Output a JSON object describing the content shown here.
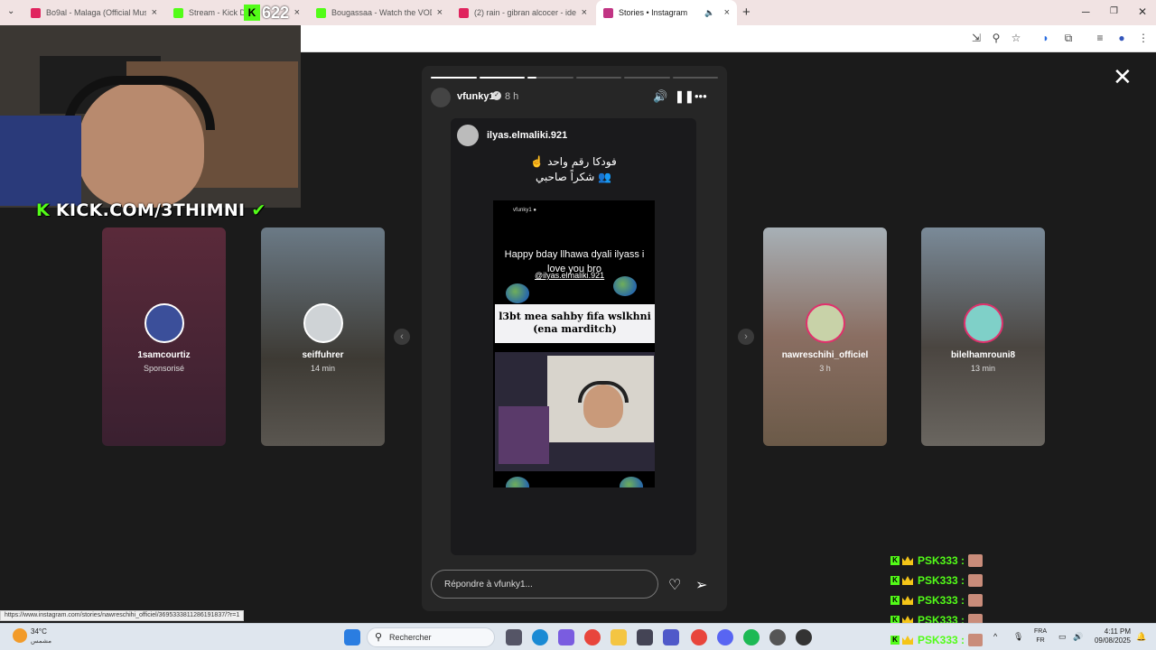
{
  "browser": {
    "tabs": [
      {
        "title": "Bo9al - Malaga (Official Music V",
        "color": "#e0245e"
      },
      {
        "title": "Stream - Kick Dash",
        "color": "#53fc18"
      },
      {
        "title": "Bougassaa - Watch the VOD on",
        "color": "#53fc18"
      },
      {
        "title": "(2) rain - gibran alcocer - ideas",
        "color": "#e0245e"
      },
      {
        "title": "Stories • Instagram",
        "color": "#c13584"
      }
    ],
    "new_tab": "+",
    "status_url": "https://www.instagram.com/stories/nawreschihi_officiel/3695333811286191837/?r=1"
  },
  "overlay": {
    "kick_viewers": "622",
    "kick_url": "KICK.COM/3THIMNI",
    "chat": [
      {
        "user": "PSK333 :"
      },
      {
        "user": "PSK333 :"
      },
      {
        "user": "PSK333 :"
      },
      {
        "user": "PSK333 :"
      },
      {
        "user": "PSK333 :"
      }
    ]
  },
  "stories_left": [
    {
      "user": "1samcourtiz",
      "meta": "Sponsorisé"
    },
    {
      "user": "seiffuhrer",
      "meta": "14 min"
    }
  ],
  "stories_right": [
    {
      "user": "nawreschihi_officiel",
      "meta": "3 h"
    },
    {
      "user": "bilelhamrouni8",
      "meta": "13 min"
    }
  ],
  "story": {
    "progress": [
      1,
      1,
      0.2,
      0,
      0,
      0
    ],
    "user": "vfunky1",
    "verified_mark": "✓",
    "time": "8 h",
    "inner_user": "ilyas.elmaliki.921",
    "arabic_line1": "☝️ فودكا رقم واحد",
    "arabic_line2": "شكراً صاحبي 👥",
    "shot_user": "vfunky1 ●",
    "shot_text": "Happy bday llhawa dyali ilyass i love you bro",
    "shot_mention": "@ilyas.elmaliki.921",
    "shot_caption": "l3bt mea sahby fifa wslkhni (ena marditch)",
    "reply_placeholder": "Répondre à vfunky1..."
  },
  "taskbar": {
    "temp": "34°C",
    "condition": "مشمس",
    "search": "Rechercher",
    "lang1": "FRA",
    "lang2": "FR",
    "time": "4:11 PM",
    "date": "09/08/2025"
  }
}
